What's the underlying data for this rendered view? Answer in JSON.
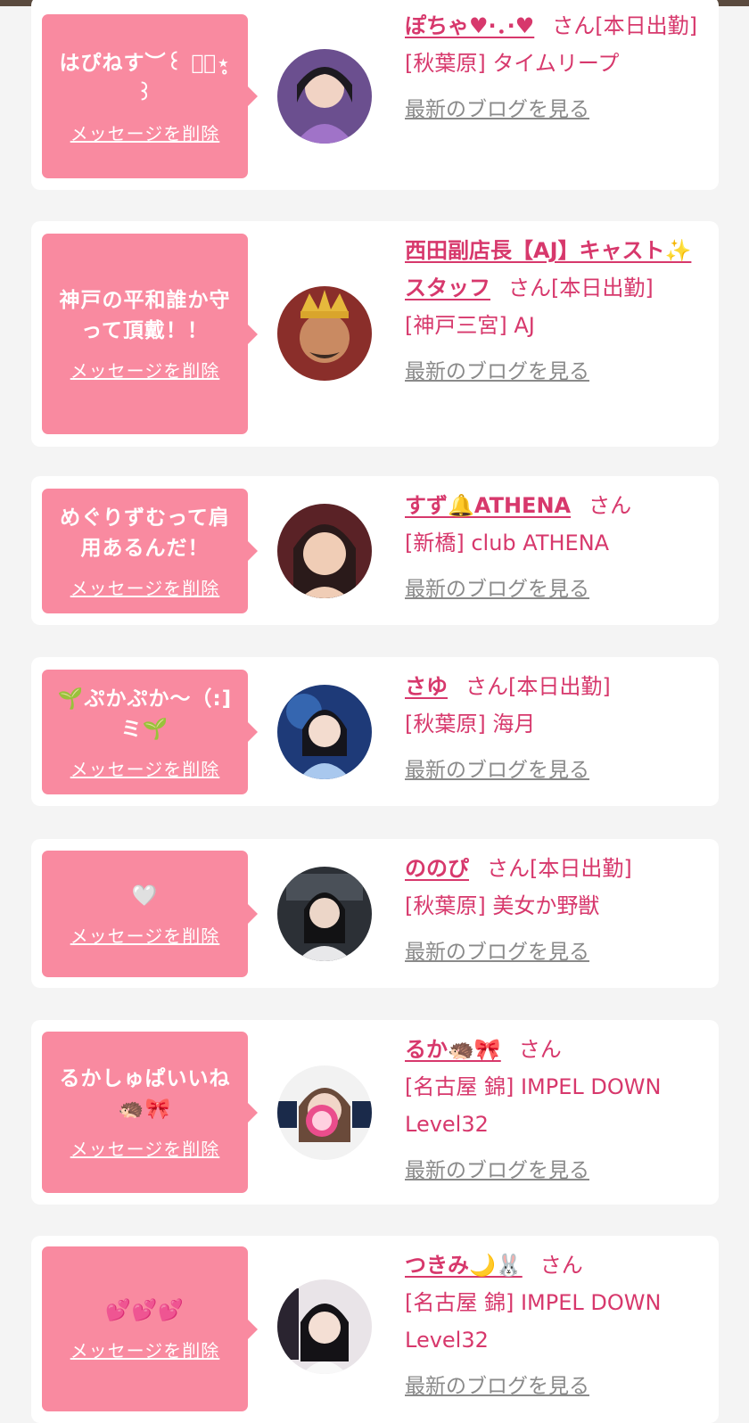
{
  "entries": [
    {
      "message": "はぴねす︶꒰ ་͙⋆̥ ꒱",
      "delete_label": "メッセージを削除",
      "name": "ぽちゃ♥︎·．·♥︎",
      "honorific": "さん",
      "status": "[本日出勤]",
      "shop": "[秋葉原] タイムリープ",
      "blog_link": "最新のブログを見る",
      "avatar": "cast-photo"
    },
    {
      "message": "神戸の平和誰か守って頂戴！！",
      "delete_label": "メッセージを削除",
      "name": "西田副店長【AJ】キャスト✨スタッフ",
      "honorific": "さん",
      "status": "[本日出勤]",
      "shop": "[神戸三宮] AJ",
      "blog_link": "最新のブログを見る",
      "avatar": "crown-photo"
    },
    {
      "message": "めぐりずむって肩用あるんだ！",
      "delete_label": "メッセージを削除",
      "name": "すず🔔ATHENA",
      "honorific": "さん",
      "status": "",
      "shop": "[新橋] club ATHENA",
      "blog_link": "最新のブログを見る",
      "avatar": "cast-photo"
    },
    {
      "message": "🌱ぷかぷか〜（:]ミ🌱",
      "delete_label": "メッセージを削除",
      "name": "さゆ",
      "honorific": "さん",
      "status": "[本日出勤]",
      "shop": "[秋葉原] 海月",
      "blog_link": "最新のブログを見る",
      "avatar": "cast-photo"
    },
    {
      "message": "🤍",
      "delete_label": "メッセージを削除",
      "name": "ののぴ",
      "honorific": "さん",
      "status": "[本日出勤]",
      "shop": "[秋葉原] 美女か野獣",
      "blog_link": "最新のブログを見る",
      "avatar": "cast-photo"
    },
    {
      "message": "るかしゅぱいいね🦔🎀",
      "delete_label": "メッセージを削除",
      "name": "るか🦔🎀",
      "honorific": "さん",
      "status": "",
      "shop": "[名古屋 錦] IMPEL DOWN Level32",
      "blog_link": "最新のブログを見る",
      "avatar": "cast-photo"
    },
    {
      "message": "💕💕💕",
      "delete_label": "メッセージを削除",
      "name": "つきみ🌙🐰",
      "honorific": "さん",
      "status": "",
      "shop": "[名古屋 錦] IMPEL DOWN Level32",
      "blog_link": "最新のブログを見る",
      "avatar": "cast-photo"
    }
  ],
  "colors": {
    "bubble": "#f98aa0",
    "accent": "#d7386c",
    "link_gray": "#8a8a8a",
    "card": "#ffffff",
    "page_bg": "#f4f4f4"
  }
}
